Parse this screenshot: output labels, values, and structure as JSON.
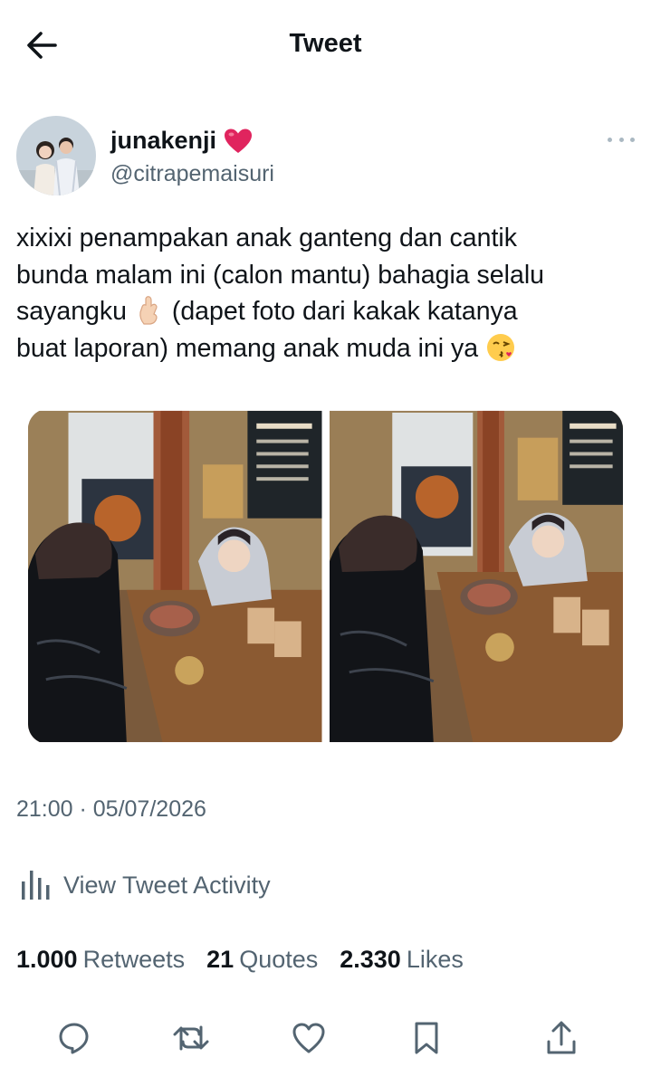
{
  "header": {
    "title": "Tweet",
    "back_icon": "arrow-left-icon"
  },
  "author": {
    "display_name": "junakenji",
    "badge_emoji": "heart-emoji",
    "handle": "@citrapemaisuri",
    "more_icon": "more-horizontal-icon"
  },
  "tweet": {
    "text_line1": "xixixi penampakan anak ganteng dan cantik",
    "text_line2": "bunda malam ini (calon mantu) bahagia selalu",
    "text_line3a": "sayangku ",
    "text_line3b": " (dapet foto dari kakak katanya",
    "text_line4a": "buat laporan) memang anak muda ini ya ",
    "timestamp": "21:00 · 05/07/2026"
  },
  "media": {
    "count": 2
  },
  "activity": {
    "label": "View Tweet Activity",
    "icon": "bar-chart-icon"
  },
  "stats": {
    "retweets_count": "1.000",
    "retweets_label": "Retweets",
    "quotes_count": "21",
    "quotes_label": "Quotes",
    "likes_count": "2.330",
    "likes_label": "Likes"
  },
  "actions": [
    "reply-icon",
    "retweet-icon",
    "like-icon",
    "bookmark-icon",
    "share-icon"
  ],
  "colors": {
    "text": "#0f1419",
    "secondary": "#536471",
    "heart": "#e0245e"
  }
}
